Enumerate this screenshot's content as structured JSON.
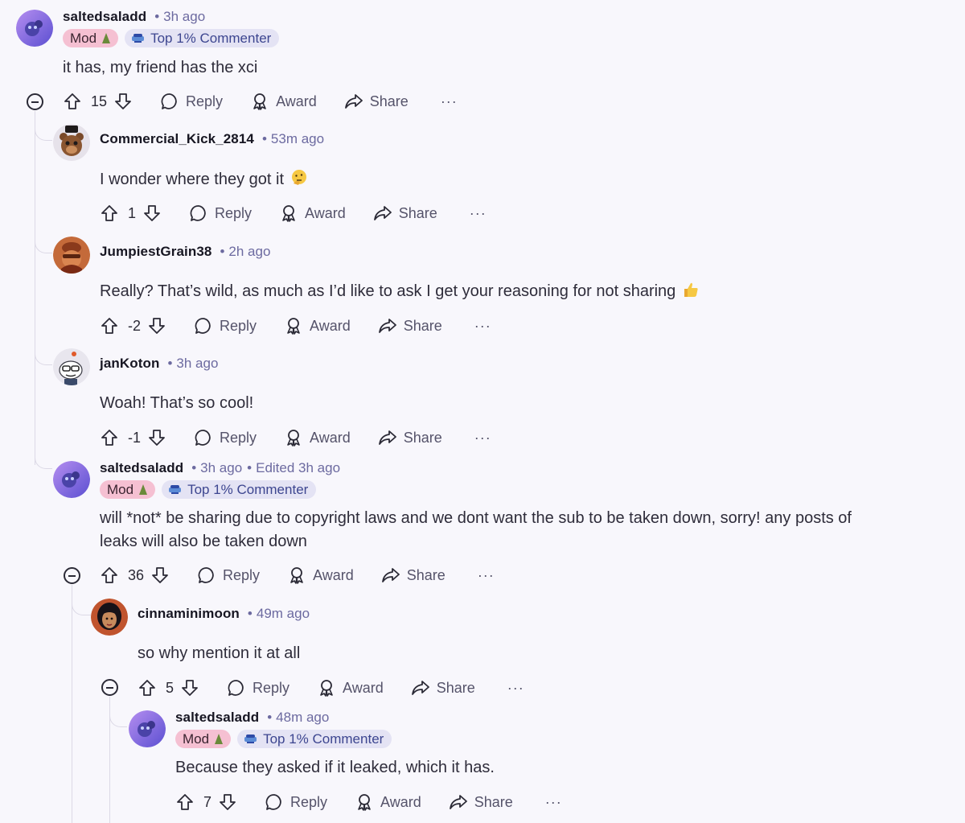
{
  "flairs": {
    "mod": "Mod",
    "top": "Top 1% Commenter"
  },
  "actions": {
    "reply": "Reply",
    "award": "Award",
    "share": "Share",
    "more": "···"
  },
  "colors": {
    "username": "#171622",
    "time": "#6c6aa0",
    "mod_flair": "#f5c0d2",
    "top_flair": "#e4e3f4",
    "rail": "#dcd9e6"
  },
  "comments": [
    {
      "author": "saltedsaladd",
      "time": "3h ago",
      "body": "it has, my friend has the xci",
      "score": "15",
      "flair_mod": true,
      "flair_top": true,
      "avatar": "purple-snoo-avatar"
    },
    {
      "author": "Commercial_Kick_2814",
      "time": "53m ago",
      "body": "I wonder where they got it",
      "emoji": "thinking-face-emoji",
      "score": "1",
      "avatar": "bear-avatar"
    },
    {
      "author": "JumpiestGrain38",
      "time": "2h ago",
      "body": "Really? That’s wild, as much as I’d like to ask I get your reasoning for not sharing",
      "emoji": "thumbs-up-emoji",
      "score": "-2",
      "avatar": "orange-character-avatar"
    },
    {
      "author": "janKoton",
      "time": "3h ago",
      "body": "Woah! That’s so cool!",
      "score": "-1",
      "avatar": "snoo-glasses-avatar"
    },
    {
      "author": "saltedsaladd",
      "time": "3h ago",
      "edited": "Edited 3h ago",
      "body": "will *not* be sharing due to copyright laws and we dont want the sub to be taken down, sorry! any posts of leaks will also be taken down",
      "score": "36",
      "flair_mod": true,
      "flair_top": true,
      "avatar": "purple-snoo-avatar"
    },
    {
      "author": "cinnaminimoon",
      "time": "49m ago",
      "body": "so why mention it at all",
      "score": "5",
      "avatar": "princess-avatar"
    },
    {
      "author": "saltedsaladd",
      "time": "48m ago",
      "body": "Because they asked if it leaked, which it has.",
      "score": "7",
      "flair_mod": true,
      "flair_top": true,
      "avatar": "purple-snoo-avatar"
    }
  ]
}
